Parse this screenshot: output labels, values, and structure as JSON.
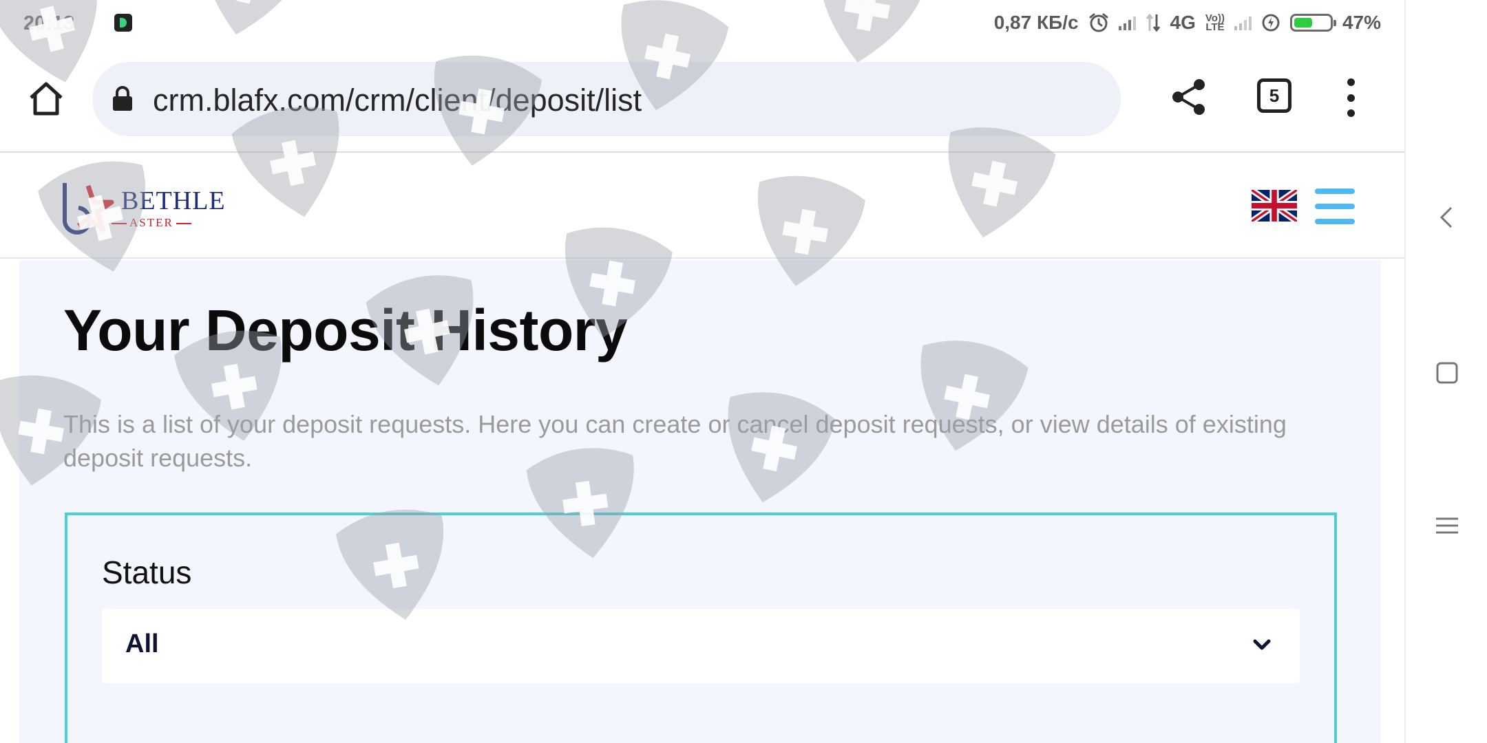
{
  "status_bar": {
    "time": "20:13",
    "net_speed": "0,87 КБ/с",
    "network": "4G",
    "volte_top": "Vo))",
    "volte_bottom": "LTE",
    "battery": "47%",
    "battery_level": 0.47,
    "icons": [
      "app-notification-icon",
      "alarm-icon",
      "signal-icon",
      "data-arrows-icon",
      "charging-icon",
      "battery-icon"
    ]
  },
  "browser": {
    "url": "crm.blafx.com/crm/client/deposit/list",
    "tab_count": "5",
    "icons": [
      "home-icon",
      "lock-icon",
      "share-icon",
      "tabs-icon",
      "more-menu-icon"
    ]
  },
  "header": {
    "logo_word": "BETHLE",
    "logo_sub": "ASTER",
    "language_icon": "uk-flag-icon",
    "menu_icon": "hamburger-icon"
  },
  "main": {
    "title": "Your Deposit History",
    "description": "This is a list of your deposit requests. Here you can create or cancel deposit requests, or view details of existing deposit requests.",
    "filter": {
      "label": "Status",
      "selected": "All"
    }
  },
  "colors": {
    "accent": "#4ecdd8",
    "brand_blue": "#1d2c78",
    "brand_red": "#c6262c",
    "menu_blue": "#4fb8f0",
    "page_bg": "#f3f6fd"
  }
}
